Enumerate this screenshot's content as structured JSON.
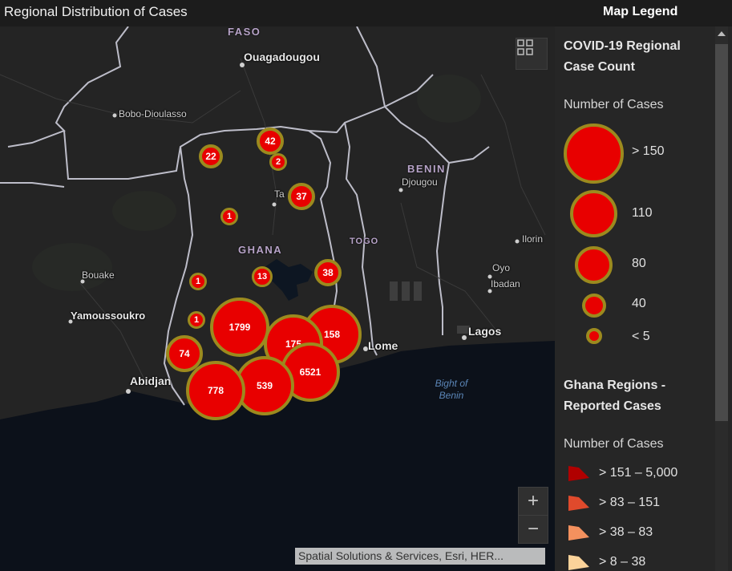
{
  "header": {
    "title": "Regional Distribution of Cases",
    "legend_title": "Map Legend"
  },
  "map": {
    "places": [
      {
        "name": "Ouagadougou",
        "big": true
      },
      {
        "name": "Bobo-Dioulasso",
        "big": false
      },
      {
        "name": "Tamale",
        "display": "Ta",
        "big": false
      },
      {
        "name": "Djougou",
        "big": false
      },
      {
        "name": "Bouake",
        "big": false
      },
      {
        "name": "Yamoussoukro",
        "big": true
      },
      {
        "name": "Oyo",
        "big": false
      },
      {
        "name": "Ilorin",
        "big": false
      },
      {
        "name": "Ibadan",
        "big": false
      },
      {
        "name": "Lagos",
        "big": true
      },
      {
        "name": "Lome",
        "big": true
      },
      {
        "name": "Abidjan",
        "big": true
      }
    ],
    "countries": [
      "FASO",
      "BENIN",
      "GHANA",
      "TOGO"
    ],
    "water": {
      "line1": "Bight of",
      "line2": "Benin"
    },
    "clusters": [
      {
        "label": "42",
        "cases": 42
      },
      {
        "label": "22",
        "cases": 22
      },
      {
        "label": "2",
        "cases": 2
      },
      {
        "label": "37",
        "cases": 37
      },
      {
        "label": "1",
        "cases": 1
      },
      {
        "label": "38",
        "cases": 38
      },
      {
        "label": "13",
        "cases": 13
      },
      {
        "label": "1",
        "cases": 1
      },
      {
        "label": "1",
        "cases": 1
      },
      {
        "label": "1799",
        "cases": 1799
      },
      {
        "label": "158",
        "cases": 158
      },
      {
        "label": "175",
        "cases": 175
      },
      {
        "label": "74",
        "cases": 74
      },
      {
        "label": "6521",
        "cases": 6521
      },
      {
        "label": "539",
        "cases": 539
      },
      {
        "label": "778",
        "cases": 778
      }
    ],
    "zoom_in": "+",
    "zoom_out": "−",
    "attribution": "Spatial Solutions & Services, Esri, HER..."
  },
  "legend": {
    "section1_title_line1": "COVID-19 Regional",
    "section1_title_line2": "Case Count",
    "section1_sub": "Number of Cases",
    "circles": [
      {
        "label": "> 150"
      },
      {
        "label": "110"
      },
      {
        "label": "80"
      },
      {
        "label": "40"
      },
      {
        "label": "< 5"
      }
    ],
    "section2_title_line1": "Ghana Regions -",
    "section2_title_line2": "Reported Cases",
    "section2_sub": "Number of Cases",
    "regions": [
      {
        "label": "> 151 – 5,000",
        "color": "#b00000"
      },
      {
        "label": "> 83 – 151",
        "color": "#e04a2c"
      },
      {
        "label": "> 38 – 83",
        "color": "#f4915e"
      },
      {
        "label": "> 8 – 38",
        "color": "#fbd39a"
      }
    ]
  },
  "colors": {
    "cluster_fill": "#e80000",
    "cluster_border": "#9c8a1e",
    "ocean": "#0c111a",
    "land": "#242424"
  }
}
